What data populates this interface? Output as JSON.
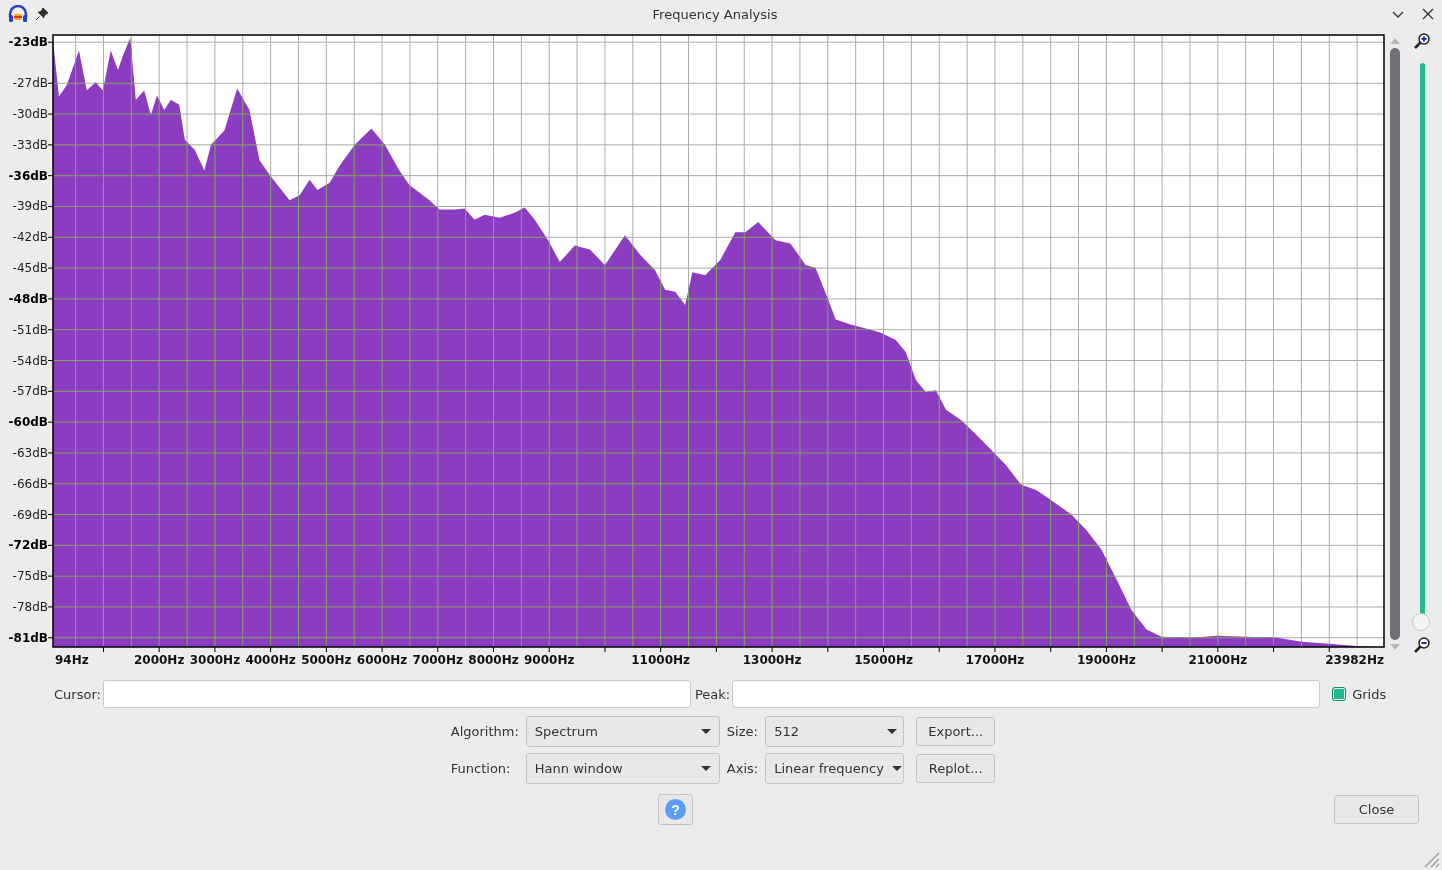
{
  "window": {
    "title": "Frequency Analysis"
  },
  "chart": {
    "chart_data": {
      "type": "area",
      "x": [
        94,
        200,
        340,
        560,
        700,
        860,
        990,
        1130,
        1260,
        1350,
        1480,
        1580,
        1730,
        1850,
        1960,
        2090,
        2210,
        2360,
        2460,
        2640,
        2810,
        2930,
        3170,
        3400,
        3620,
        3800,
        3980,
        4340,
        4520,
        4700,
        4840,
        5060,
        5240,
        5510,
        5810,
        6050,
        6310,
        6490,
        6850,
        7030,
        7300,
        7480,
        7660,
        7840,
        8110,
        8380,
        8560,
        8740,
        8980,
        9190,
        9460,
        9730,
        10000,
        10360,
        10630,
        10900,
        11080,
        11260,
        11440,
        11570,
        11800,
        12070,
        12340,
        12520,
        12750,
        13060,
        13330,
        13600,
        13780,
        14010,
        14140,
        14410,
        14770,
        14950,
        15220,
        15400,
        15580,
        15760,
        15940,
        16120,
        16390,
        16660,
        16930,
        17200,
        17470,
        17740,
        18010,
        18370,
        18640,
        18910,
        19180,
        19450,
        19720,
        19990,
        20530,
        20980,
        21520,
        22060,
        22510,
        23050,
        23490,
        23982
      ],
      "series": [
        {
          "color": "#8b3cc1",
          "values": [
            -22.8,
            -28.3,
            -27.2,
            -23.8,
            -27.7,
            -26.9,
            -27.7,
            -23.8,
            -25.7,
            -24.3,
            -22.6,
            -28.6,
            -27.7,
            -30.1,
            -28.2,
            -29.6,
            -28.6,
            -29.1,
            -32.5,
            -33.5,
            -35.5,
            -33.0,
            -31.6,
            -27.5,
            -29.6,
            -34.5,
            -35.9,
            -38.4,
            -37.9,
            -36.4,
            -37.4,
            -36.7,
            -35.0,
            -33.0,
            -31.4,
            -33.0,
            -35.5,
            -36.9,
            -38.4,
            -39.3,
            -39.3,
            -39.2,
            -40.3,
            -39.8,
            -40.1,
            -39.6,
            -39.1,
            -40.3,
            -42.3,
            -44.4,
            -42.8,
            -43.2,
            -44.7,
            -41.8,
            -43.7,
            -45.2,
            -47.1,
            -47.3,
            -48.6,
            -45.4,
            -45.7,
            -44.2,
            -41.5,
            -41.5,
            -40.5,
            -42.3,
            -42.6,
            -44.7,
            -45.0,
            -48.1,
            -50.0,
            -50.5,
            -51.0,
            -51.3,
            -52.0,
            -53.2,
            -55.9,
            -57.1,
            -56.9,
            -58.8,
            -59.8,
            -61.2,
            -62.7,
            -64.2,
            -66.1,
            -66.6,
            -67.6,
            -69.0,
            -70.5,
            -72.4,
            -75.3,
            -78.3,
            -80.2,
            -80.9,
            -81.0,
            -80.8,
            -80.9,
            -81.0,
            -81.4,
            -81.6,
            -81.8,
            -81.9
          ]
        }
      ],
      "grid": true,
      "xlim": [
        94,
        23982
      ],
      "ylim": [
        -81.9,
        -22.3
      ],
      "xticks": [
        {
          "value": 94,
          "label": "94Hz"
        },
        {
          "value": 2000,
          "label": "2000Hz"
        },
        {
          "value": 3000,
          "label": "3000Hz"
        },
        {
          "value": 4000,
          "label": "4000Hz"
        },
        {
          "value": 5000,
          "label": "5000Hz"
        },
        {
          "value": 6000,
          "label": "6000Hz"
        },
        {
          "value": 7000,
          "label": "7000Hz"
        },
        {
          "value": 8000,
          "label": "8000Hz"
        },
        {
          "value": 9000,
          "label": "9000Hz"
        },
        {
          "value": 11000,
          "label": "11000Hz"
        },
        {
          "value": 13000,
          "label": "13000Hz"
        },
        {
          "value": 15000,
          "label": "15000Hz"
        },
        {
          "value": 17000,
          "label": "17000Hz"
        },
        {
          "value": 19000,
          "label": "19000Hz"
        },
        {
          "value": 21000,
          "label": "21000Hz"
        },
        {
          "value": 23982,
          "label": "23982Hz"
        }
      ],
      "yticks": [
        {
          "value": -23,
          "label": "-23dB"
        },
        {
          "value": -27,
          "label": "-27dB"
        },
        {
          "value": -30,
          "label": "-30dB"
        },
        {
          "value": -33,
          "label": "-33dB"
        },
        {
          "value": -36,
          "label": "-36dB"
        },
        {
          "value": -39,
          "label": "-39dB"
        },
        {
          "value": -42,
          "label": "-42dB"
        },
        {
          "value": -45,
          "label": "-45dB"
        },
        {
          "value": -48,
          "label": "-48dB"
        },
        {
          "value": -51,
          "label": "-51dB"
        },
        {
          "value": -54,
          "label": "-54dB"
        },
        {
          "value": -57,
          "label": "-57dB"
        },
        {
          "value": -60,
          "label": "-60dB"
        },
        {
          "value": -63,
          "label": "-63dB"
        },
        {
          "value": -66,
          "label": "-66dB"
        },
        {
          "value": -69,
          "label": "-69dB"
        },
        {
          "value": -72,
          "label": "-72dB"
        },
        {
          "value": -75,
          "label": "-75dB"
        },
        {
          "value": -78,
          "label": "-78dB"
        },
        {
          "value": -81,
          "label": "-81dB"
        }
      ]
    }
  },
  "zoom_slider": {
    "level": 0
  },
  "cursor": {
    "label": "Cursor:"
  },
  "peak": {
    "label": "Peak:"
  },
  "grids": {
    "label": "Grids",
    "checked": true
  },
  "algorithm": {
    "label": "Algorithm:",
    "value": "Spectrum"
  },
  "size": {
    "label": "Size:",
    "value": "512"
  },
  "export_button": "Export...",
  "function": {
    "label": "Function:",
    "value": "Hann window"
  },
  "axis": {
    "label": "Axis:",
    "value": "Linear frequency"
  },
  "replot_button": "Replot...",
  "help_button": "?",
  "close_button": "Close"
}
